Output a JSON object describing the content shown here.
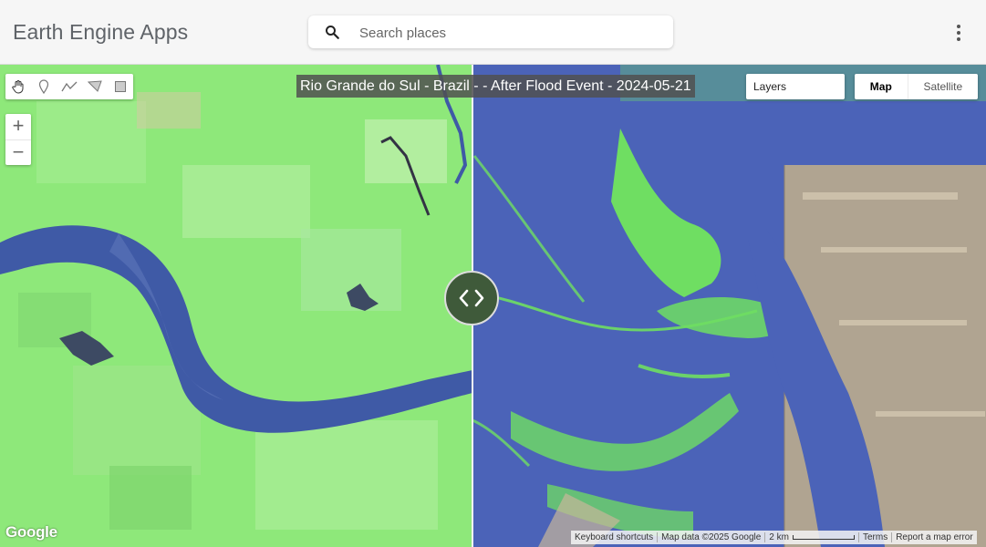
{
  "header": {
    "app_title": "Earth Engine Apps",
    "search_placeholder": "Search places",
    "search_icon": "search-icon",
    "menu_icon": "more-vert-icon"
  },
  "map": {
    "title": "Rio Grande do Sul - Brazil - - After Flood Event - 2024-05-21",
    "layers_label": "Layers",
    "map_type": {
      "map_label": "Map",
      "satellite_label": "Satellite",
      "selected": "Map"
    },
    "zoom_in": "+",
    "zoom_out": "−",
    "drawing_tools": [
      "hand-icon",
      "marker-icon",
      "polyline-icon",
      "polygon-icon",
      "rectangle-icon"
    ],
    "slider_icon": "split-compare-icon",
    "logo": "Google",
    "footer": {
      "keyboard": "Keyboard shortcuts",
      "map_data": "Map data ©2025 Google",
      "scale": "2 km",
      "terms": "Terms",
      "report": "Report a map error"
    }
  },
  "colors": {
    "land_left": "#8ee87a",
    "land_right": "#6fde62",
    "water": "#3f5aa6",
    "flood_water": "#4b63b8",
    "header_bg": "#f6f6f6"
  }
}
